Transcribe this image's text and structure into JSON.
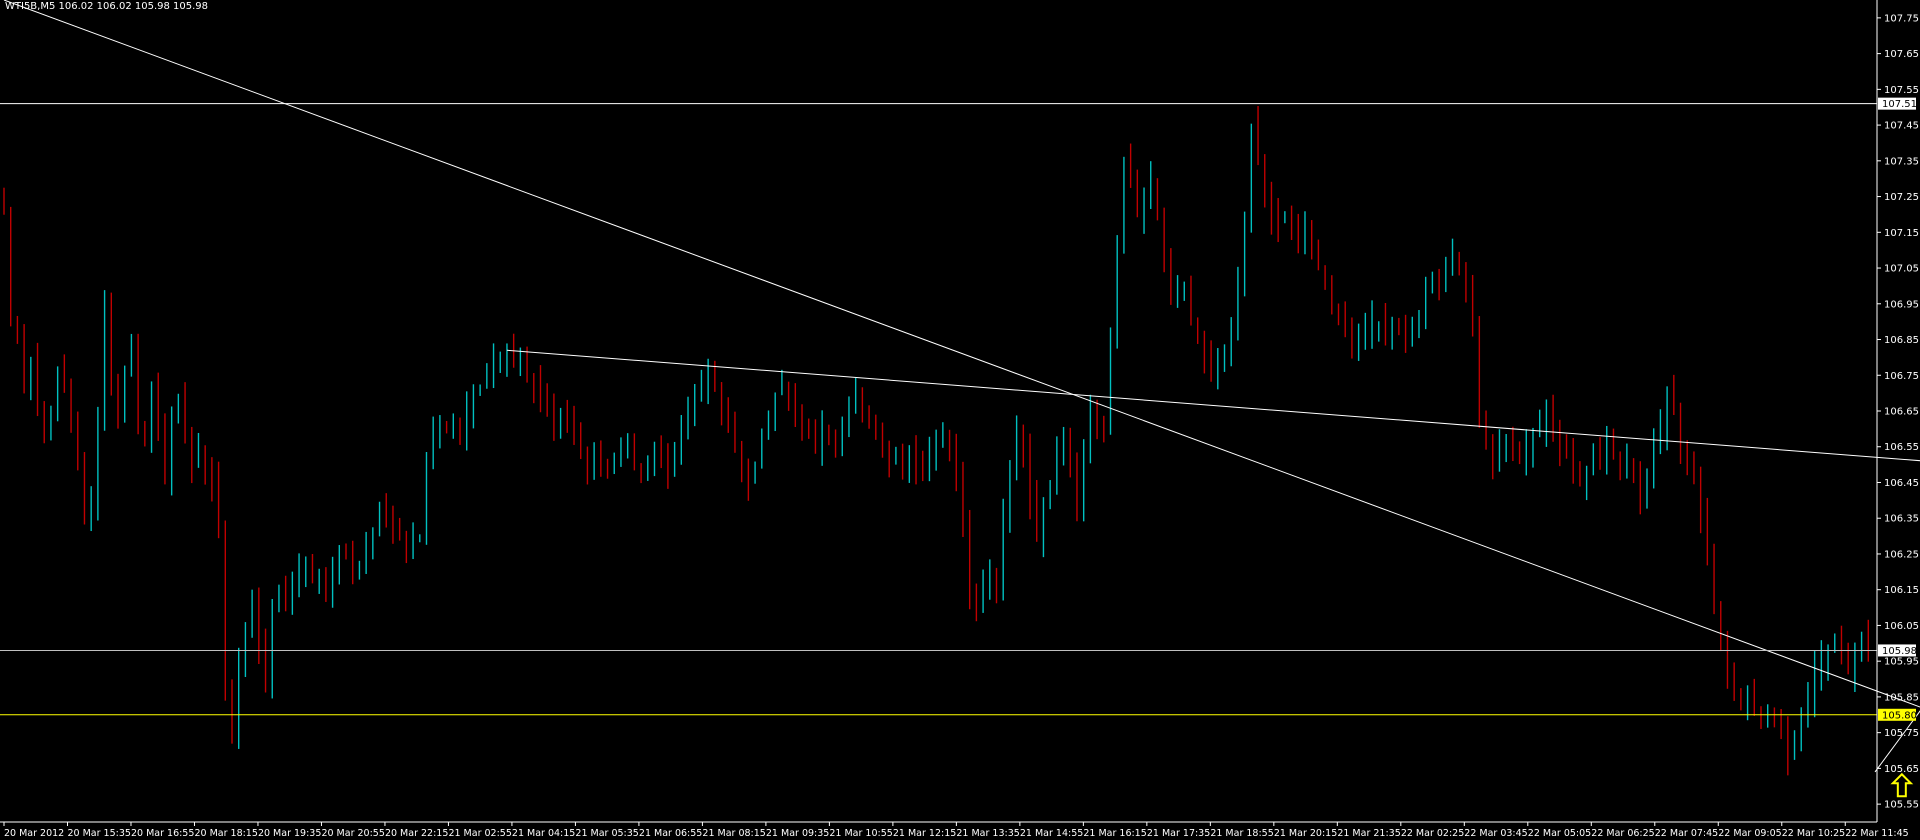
{
  "header": {
    "symbol_info": "WTI5B,M5  106.02 106.02 105.98 105.98"
  },
  "colors": {
    "background": "#000000",
    "bull": "#00c0c0",
    "bear": "#c00000",
    "axis_text": "#ffffff",
    "trendline": "#ffffff",
    "support_line": "#ffff00",
    "price_line": "#c0c0c0",
    "arrow": "#ffff00"
  },
  "chart_data": {
    "type": "candlestick",
    "symbol": "WTI5B",
    "timeframe": "M5",
    "ylim": [
      105.5,
      107.8
    ],
    "y_ticks": [
      107.75,
      107.65,
      107.55,
      107.45,
      107.35,
      107.25,
      107.15,
      107.05,
      106.95,
      106.85,
      106.75,
      106.65,
      106.55,
      106.45,
      106.35,
      106.25,
      106.15,
      106.05,
      105.95,
      105.85,
      105.75,
      105.65,
      105.55
    ],
    "x_ticks": [
      "20 Mar 2012",
      "20 Mar 15:35",
      "20 Mar 16:55",
      "20 Mar 18:15",
      "20 Mar 19:35",
      "20 Mar 20:55",
      "20 Mar 22:15",
      "21 Mar 02:55",
      "21 Mar 04:15",
      "21 Mar 05:35",
      "21 Mar 06:55",
      "21 Mar 08:15",
      "21 Mar 09:35",
      "21 Mar 10:55",
      "21 Mar 12:15",
      "21 Mar 13:35",
      "21 Mar 14:55",
      "21 Mar 16:15",
      "21 Mar 17:35",
      "21 Mar 18:55",
      "21 Mar 20:15",
      "21 Mar 21:35",
      "22 Mar 02:25",
      "22 Mar 03:45",
      "22 Mar 05:05",
      "22 Mar 06:25",
      "22 Mar 07:45",
      "22 Mar 09:05",
      "22 Mar 10:25",
      "22 Mar 11:45"
    ],
    "price_markers": [
      {
        "label": "107.51",
        "value": 107.51,
        "kind": "resistance"
      },
      {
        "label": "105.98",
        "value": 105.98,
        "kind": "current"
      },
      {
        "label": "105.80",
        "value": 105.8,
        "kind": "support"
      }
    ],
    "trendlines": [
      {
        "from": {
          "bar": 0,
          "price": 107.8
        },
        "to": {
          "bar": 292,
          "price": 105.77
        }
      },
      {
        "from": {
          "bar": 75,
          "price": 106.82
        },
        "to": {
          "bar": 292,
          "price": 106.5
        }
      },
      {
        "from": {
          "bar": 279,
          "price": 105.64
        },
        "to": {
          "bar": 292,
          "price": 106.0
        }
      }
    ],
    "arrow_marker": {
      "bar": 283,
      "price": 105.6,
      "direction": "up"
    },
    "closes": [
      107.2,
      106.9,
      106.85,
      106.7,
      106.8,
      106.65,
      106.6,
      106.65,
      106.75,
      106.72,
      106.6,
      106.5,
      106.35,
      106.4,
      106.65,
      106.95,
      106.7,
      106.65,
      106.75,
      106.85,
      106.6,
      106.58,
      106.72,
      106.6,
      106.45,
      106.62,
      106.68,
      106.6,
      106.5,
      106.55,
      106.48,
      106.45,
      106.3,
      105.85,
      105.72,
      105.95,
      106.05,
      106.1,
      106.0,
      105.9,
      106.12,
      106.15,
      106.1,
      106.15,
      106.2,
      106.22,
      106.18,
      106.2,
      106.15,
      106.22,
      106.25,
      106.24,
      106.2,
      106.23,
      106.28,
      106.32,
      106.38,
      106.35,
      106.32,
      106.3,
      106.28,
      106.3,
      106.3,
      106.5,
      106.6,
      106.62,
      106.6,
      106.6,
      106.58,
      106.65,
      106.7,
      106.72,
      106.75,
      106.78,
      106.8,
      106.82,
      106.78,
      106.8,
      106.75,
      106.72,
      106.7,
      106.68,
      106.62,
      106.65,
      106.62,
      106.6,
      106.55,
      106.5,
      106.52,
      106.5,
      106.48,
      106.5,
      106.52,
      106.55,
      106.5,
      106.48,
      106.5,
      106.55,
      106.5,
      106.48,
      106.52,
      106.6,
      106.65,
      106.7,
      106.72,
      106.75,
      106.72,
      106.65,
      106.6,
      106.55,
      106.48,
      106.45,
      106.5,
      106.58,
      106.65,
      106.7,
      106.72,
      106.68,
      106.62,
      106.6,
      106.58,
      106.55,
      106.6,
      106.58,
      106.55,
      106.62,
      106.65,
      106.7,
      106.65,
      106.62,
      106.6,
      106.55,
      106.5,
      106.52,
      106.5,
      106.55,
      106.5,
      106.48,
      106.52,
      106.55,
      106.58,
      106.55,
      106.45,
      106.35,
      106.15,
      106.1,
      106.15,
      106.2,
      106.15,
      106.35,
      106.5,
      106.6,
      106.55,
      106.4,
      106.3,
      106.4,
      106.45,
      106.55,
      106.6,
      106.5,
      106.4,
      106.55,
      106.65,
      106.62,
      106.6,
      106.85,
      107.1,
      107.35,
      107.3,
      107.2,
      107.25,
      107.3,
      107.2,
      107.05,
      106.95,
      106.98,
      107.0,
      106.9,
      106.85,
      106.8,
      106.75,
      106.8,
      106.82,
      106.9,
      107.0,
      107.2,
      107.45,
      107.35,
      107.25,
      107.2,
      107.18,
      107.2,
      107.15,
      107.12,
      107.15,
      107.1,
      107.05,
      107.0,
      106.95,
      106.9,
      106.88,
      106.85,
      106.85,
      106.88,
      106.9,
      106.9,
      106.88,
      106.9,
      106.88,
      106.85,
      106.88,
      106.9,
      107.0,
      107.02,
      107.0,
      107.05,
      107.08,
      107.05,
      107.0,
      106.9,
      106.65,
      106.55,
      106.5,
      106.55,
      106.58,
      106.55,
      106.52,
      106.55,
      106.58,
      106.6,
      106.65,
      106.62,
      106.55,
      106.52,
      106.5,
      106.45,
      106.48,
      106.55,
      106.5,
      106.55,
      106.52,
      106.48,
      106.5,
      106.45,
      106.42,
      106.45,
      106.55,
      106.6,
      106.7,
      106.65,
      106.55,
      106.5,
      106.45,
      106.35,
      106.25,
      106.1,
      106.0,
      105.9,
      105.85,
      105.82,
      105.85,
      105.8,
      105.78,
      105.82,
      105.78,
      105.75,
      105.68,
      105.72,
      105.8,
      105.85,
      105.92,
      105.95,
      105.98,
      106.0,
      105.95,
      105.92,
      105.98,
      106.02,
      105.98
    ]
  }
}
